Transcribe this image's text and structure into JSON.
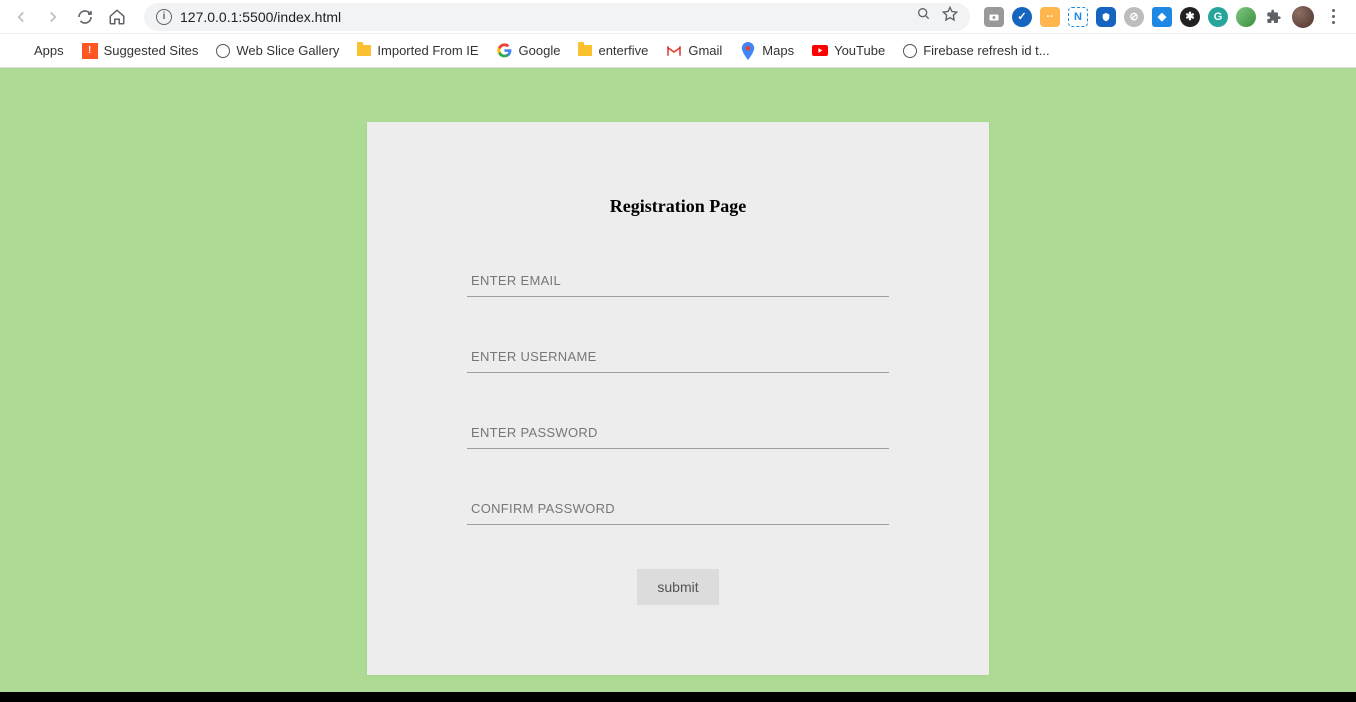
{
  "browser": {
    "url": "127.0.0.1:5500/index.html"
  },
  "bookmarks": {
    "apps": "Apps",
    "suggested": "Suggested Sites",
    "webslice": "Web Slice Gallery",
    "imported": "Imported From IE",
    "google": "Google",
    "enterfive": "enterfive",
    "gmail": "Gmail",
    "maps": "Maps",
    "youtube": "YouTube",
    "firebase": "Firebase refresh id t..."
  },
  "form": {
    "title": "Registration Page",
    "email_placeholder": "ENTER EMAIL",
    "username_placeholder": "ENTER USERNAME",
    "password_placeholder": "ENTER PASSWORD",
    "confirm_placeholder": "CONFIRM PASSWORD",
    "submit_label": "submit"
  }
}
